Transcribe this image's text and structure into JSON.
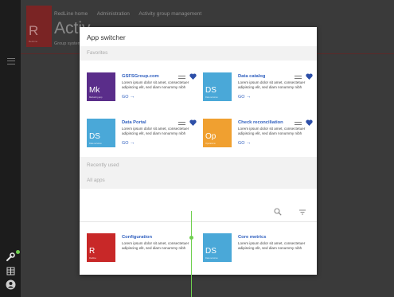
{
  "topbar": {
    "logo_letter": "R",
    "logo_caption": "RedLine",
    "breadcrumbs": [
      "RedLine home",
      "Administration",
      "Activity group management"
    ],
    "title": "Activ",
    "subtitle": "Group system"
  },
  "modal": {
    "title": "App switcher",
    "favorites_label": "Favorites",
    "recent_label": "Recently used",
    "all_label": "All apps",
    "favorites": [
      {
        "abbr": "Mk",
        "tile_caption": "Marketing app",
        "color": "#5a2d8a",
        "title": "GSFSGroup.com",
        "desc": "Lorem ipsum dolor sit amet, consectetuer adipiscing elit, sed diam nonummy nibh",
        "go": "GO"
      },
      {
        "abbr": "DS",
        "tile_caption": "Data services",
        "color": "#4aa8d8",
        "title": "Data catalog",
        "desc": "Lorem ipsum dolor sit amet, consectetuer adipiscing elit, sed diam nonummy nibh",
        "go": "GO"
      },
      {
        "abbr": "DS",
        "tile_caption": "Data services",
        "color": "#4aa8d8",
        "title": "Data Portal",
        "desc": "Lorem ipsum dolor sit amet, consectetuer adipiscing elit, sed diam nonummy nibh",
        "go": "GO"
      },
      {
        "abbr": "Op",
        "tile_caption": "Operations",
        "color": "#f0a030",
        "title": "Check reconciliation",
        "desc": "Lorem ipsum dolor sit amet, consectetuer adipiscing elit, sed diam nonummy nibh",
        "go": "GO"
      }
    ],
    "apps": [
      {
        "abbr": "R",
        "tile_caption": "Redline",
        "color": "#c82828",
        "title": "Configuration",
        "desc": "Lorem ipsum dolor sit amet, consectetuer adipiscing elit, sed diam nonummy nibh"
      },
      {
        "abbr": "DS",
        "tile_caption": "Data services",
        "color": "#4aa8d8",
        "title": "Core metrics",
        "desc": "Lorem ipsum dolor sit amet, consectetuer adipiscing elit, sed diam nonummy nibh"
      }
    ]
  },
  "colors": {
    "accent": "#2f5fbf",
    "heart": "#2d4fa8",
    "indicator": "#6fcf4f"
  }
}
